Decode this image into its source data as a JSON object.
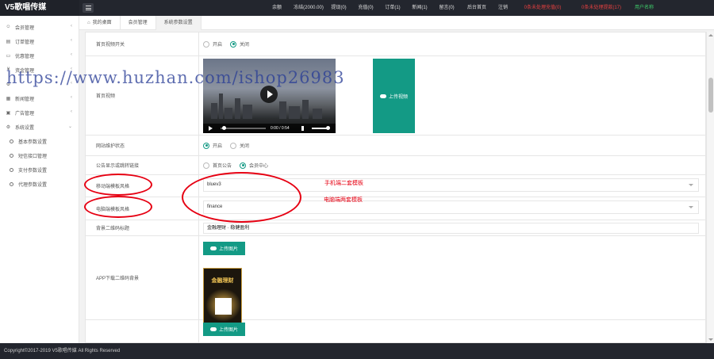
{
  "header": {
    "brand": "V5歌唱传媒",
    "nav": [
      {
        "label": "余额(100000.00)",
        "style": "normal"
      },
      {
        "label": "冻结(2000.00)",
        "style": "normal"
      },
      {
        "label": "提现(0)",
        "style": "normal"
      },
      {
        "label": "充值(0)",
        "style": "normal"
      },
      {
        "label": "订单(1)",
        "style": "normal"
      },
      {
        "label": "新闻(1)",
        "style": "normal"
      },
      {
        "label": "留言(0)",
        "style": "normal"
      },
      {
        "label": "后台首页",
        "style": "normal"
      },
      {
        "label": "注销",
        "style": "normal"
      },
      {
        "label": "0条未处理充值(0)",
        "style": "red"
      },
      {
        "label": "0条未处理提款(17)",
        "style": "red"
      },
      {
        "label": "用户名称",
        "style": "green"
      }
    ]
  },
  "sidebar": {
    "items": [
      {
        "label": "会员管理",
        "icon": "user-icon"
      },
      {
        "label": "订单管理",
        "icon": "order-icon"
      },
      {
        "label": "优惠管理",
        "icon": "coupon-icon"
      },
      {
        "label": "资金管理",
        "icon": "money-icon"
      },
      {
        "label": "",
        "icon": "gear-icon"
      },
      {
        "label": "新闻管理",
        "icon": "news-icon"
      },
      {
        "label": "广告管理",
        "icon": "ad-icon"
      },
      {
        "label": "系统设置",
        "icon": "settings-icon"
      }
    ],
    "sub_items": [
      {
        "label": "基本参数设置"
      },
      {
        "label": "短信接口管理"
      },
      {
        "label": "支付参数设置"
      },
      {
        "label": "代理参数设置"
      }
    ]
  },
  "tabs": [
    {
      "label": "我的桌面"
    },
    {
      "label": "会员管理"
    },
    {
      "label": "系统参数设置"
    }
  ],
  "form": {
    "video_switch": {
      "label": "首页视频开关",
      "options": [
        "开启",
        "关闭"
      ],
      "selected": 1
    },
    "home_video": {
      "label": "首页视频",
      "time": "0:00 / 0:54",
      "upload_label": "上传视频"
    },
    "site_maintenance": {
      "label": "网站维护状态",
      "options": [
        "开启",
        "关闭"
      ],
      "selected": 0
    },
    "announcement_link": {
      "label": "公告显示或跳转链接",
      "options": [
        "首页公告",
        "会员中心"
      ],
      "selected": 1
    },
    "mobile_theme": {
      "label": "移动端模板风格",
      "value": "bluev3"
    },
    "pc_theme": {
      "label": "电脑端模板风格",
      "value": "finance"
    },
    "bg_title": {
      "label": "背景二维码标题",
      "value": "金融理财 · 稳健盈利"
    },
    "app_qr": {
      "label": "APP下载二维码背景",
      "upload_label": "上传图片",
      "poster_title": "金融理财"
    },
    "next_upload": {
      "upload_label": "上传图片"
    }
  },
  "annotations": {
    "mobile_note": "手机端二套模板",
    "pc_note": "电脑端两套模板"
  },
  "watermark": "https://www.huzhan.com/ishop26983",
  "footer": "Copyright©2017-2019 V5歌唱传媒 All Rights Reserved",
  "colors": {
    "accent": "#139a85",
    "topbar": "#23262e",
    "annotation": "#e60012"
  }
}
